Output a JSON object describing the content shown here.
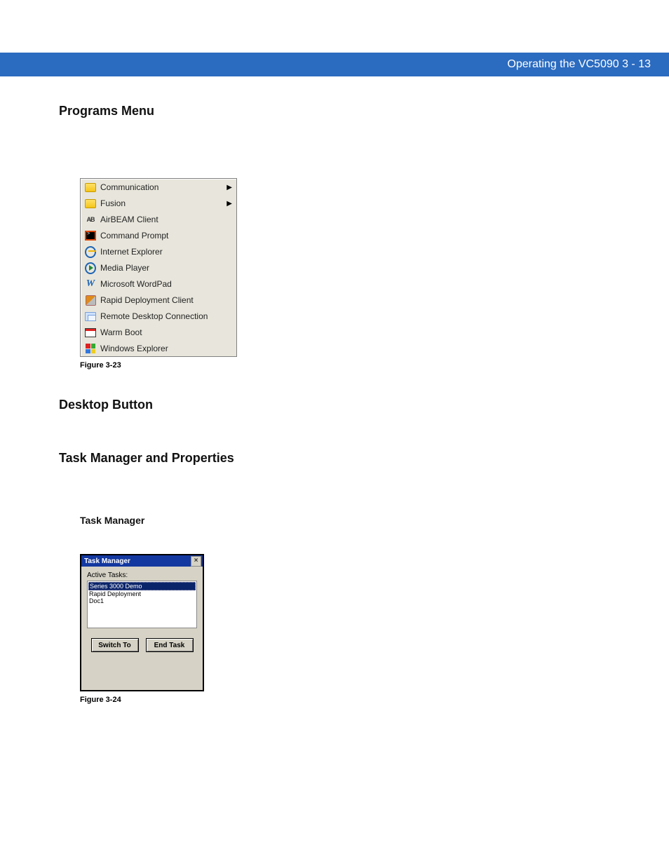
{
  "header": {
    "title": "Operating the VC5090    3 - 13"
  },
  "sections": {
    "programs_menu_heading": "Programs Menu",
    "desktop_button_heading": "Desktop Button",
    "task_mgr_props_heading": "Task Manager and Properties",
    "task_mgr_sub": "Task Manager"
  },
  "programs_menu": {
    "items": [
      {
        "label": "Communication",
        "submenu": true,
        "icon": "folder"
      },
      {
        "label": "Fusion",
        "submenu": true,
        "icon": "folder"
      },
      {
        "label": "AirBEAM Client",
        "submenu": false,
        "icon": "ab"
      },
      {
        "label": "Command Prompt",
        "submenu": false,
        "icon": "cmd"
      },
      {
        "label": "Internet Explorer",
        "submenu": false,
        "icon": "ie"
      },
      {
        "label": "Media Player",
        "submenu": false,
        "icon": "media"
      },
      {
        "label": "Microsoft WordPad",
        "submenu": false,
        "icon": "w"
      },
      {
        "label": "Rapid Deployment Client",
        "submenu": false,
        "icon": "rapid"
      },
      {
        "label": "Remote Desktop Connection",
        "submenu": false,
        "icon": "rdc"
      },
      {
        "label": "Warm Boot",
        "submenu": false,
        "icon": "warm"
      },
      {
        "label": "Windows Explorer",
        "submenu": false,
        "icon": "win"
      }
    ],
    "figure_caption": "Figure 3-23"
  },
  "task_manager": {
    "window_title": "Task Manager",
    "label_active": "Active Tasks:",
    "tasks": [
      {
        "name": "Series 3000 Demo",
        "selected": true
      },
      {
        "name": "Rapid Deployment",
        "selected": false
      },
      {
        "name": "Doc1",
        "selected": false
      }
    ],
    "btn_switch": "Switch To",
    "btn_end": "End Task",
    "figure_caption": "Figure 3-24"
  }
}
